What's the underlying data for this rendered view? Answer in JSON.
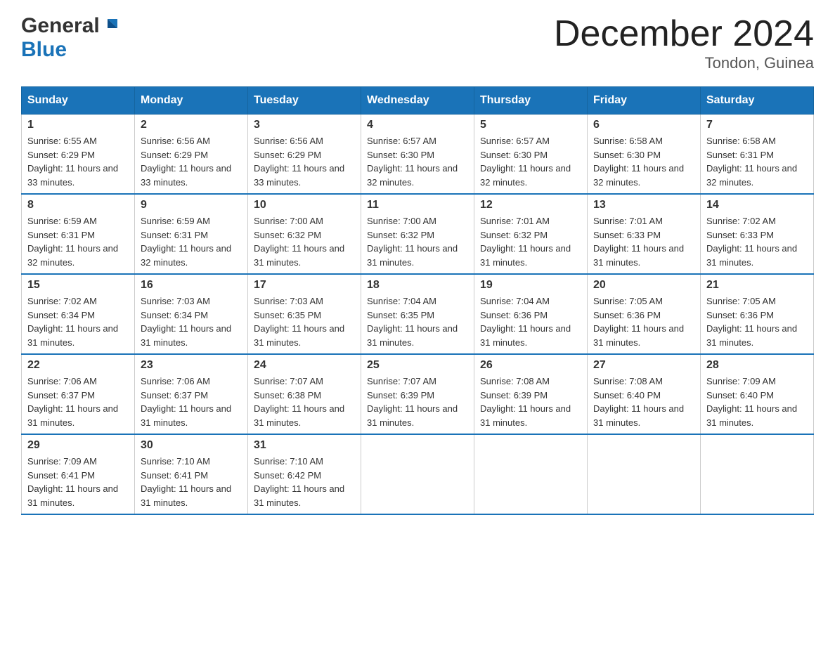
{
  "header": {
    "logo_general": "General",
    "logo_blue": "Blue",
    "title": "December 2024",
    "subtitle": "Tondon, Guinea"
  },
  "calendar": {
    "days_of_week": [
      "Sunday",
      "Monday",
      "Tuesday",
      "Wednesday",
      "Thursday",
      "Friday",
      "Saturday"
    ],
    "weeks": [
      [
        {
          "day": 1,
          "sunrise": "6:55 AM",
          "sunset": "6:29 PM",
          "daylight": "11 hours and 33 minutes."
        },
        {
          "day": 2,
          "sunrise": "6:56 AM",
          "sunset": "6:29 PM",
          "daylight": "11 hours and 33 minutes."
        },
        {
          "day": 3,
          "sunrise": "6:56 AM",
          "sunset": "6:29 PM",
          "daylight": "11 hours and 33 minutes."
        },
        {
          "day": 4,
          "sunrise": "6:57 AM",
          "sunset": "6:30 PM",
          "daylight": "11 hours and 32 minutes."
        },
        {
          "day": 5,
          "sunrise": "6:57 AM",
          "sunset": "6:30 PM",
          "daylight": "11 hours and 32 minutes."
        },
        {
          "day": 6,
          "sunrise": "6:58 AM",
          "sunset": "6:30 PM",
          "daylight": "11 hours and 32 minutes."
        },
        {
          "day": 7,
          "sunrise": "6:58 AM",
          "sunset": "6:31 PM",
          "daylight": "11 hours and 32 minutes."
        }
      ],
      [
        {
          "day": 8,
          "sunrise": "6:59 AM",
          "sunset": "6:31 PM",
          "daylight": "11 hours and 32 minutes."
        },
        {
          "day": 9,
          "sunrise": "6:59 AM",
          "sunset": "6:31 PM",
          "daylight": "11 hours and 32 minutes."
        },
        {
          "day": 10,
          "sunrise": "7:00 AM",
          "sunset": "6:32 PM",
          "daylight": "11 hours and 31 minutes."
        },
        {
          "day": 11,
          "sunrise": "7:00 AM",
          "sunset": "6:32 PM",
          "daylight": "11 hours and 31 minutes."
        },
        {
          "day": 12,
          "sunrise": "7:01 AM",
          "sunset": "6:32 PM",
          "daylight": "11 hours and 31 minutes."
        },
        {
          "day": 13,
          "sunrise": "7:01 AM",
          "sunset": "6:33 PM",
          "daylight": "11 hours and 31 minutes."
        },
        {
          "day": 14,
          "sunrise": "7:02 AM",
          "sunset": "6:33 PM",
          "daylight": "11 hours and 31 minutes."
        }
      ],
      [
        {
          "day": 15,
          "sunrise": "7:02 AM",
          "sunset": "6:34 PM",
          "daylight": "11 hours and 31 minutes."
        },
        {
          "day": 16,
          "sunrise": "7:03 AM",
          "sunset": "6:34 PM",
          "daylight": "11 hours and 31 minutes."
        },
        {
          "day": 17,
          "sunrise": "7:03 AM",
          "sunset": "6:35 PM",
          "daylight": "11 hours and 31 minutes."
        },
        {
          "day": 18,
          "sunrise": "7:04 AM",
          "sunset": "6:35 PM",
          "daylight": "11 hours and 31 minutes."
        },
        {
          "day": 19,
          "sunrise": "7:04 AM",
          "sunset": "6:36 PM",
          "daylight": "11 hours and 31 minutes."
        },
        {
          "day": 20,
          "sunrise": "7:05 AM",
          "sunset": "6:36 PM",
          "daylight": "11 hours and 31 minutes."
        },
        {
          "day": 21,
          "sunrise": "7:05 AM",
          "sunset": "6:36 PM",
          "daylight": "11 hours and 31 minutes."
        }
      ],
      [
        {
          "day": 22,
          "sunrise": "7:06 AM",
          "sunset": "6:37 PM",
          "daylight": "11 hours and 31 minutes."
        },
        {
          "day": 23,
          "sunrise": "7:06 AM",
          "sunset": "6:37 PM",
          "daylight": "11 hours and 31 minutes."
        },
        {
          "day": 24,
          "sunrise": "7:07 AM",
          "sunset": "6:38 PM",
          "daylight": "11 hours and 31 minutes."
        },
        {
          "day": 25,
          "sunrise": "7:07 AM",
          "sunset": "6:39 PM",
          "daylight": "11 hours and 31 minutes."
        },
        {
          "day": 26,
          "sunrise": "7:08 AM",
          "sunset": "6:39 PM",
          "daylight": "11 hours and 31 minutes."
        },
        {
          "day": 27,
          "sunrise": "7:08 AM",
          "sunset": "6:40 PM",
          "daylight": "11 hours and 31 minutes."
        },
        {
          "day": 28,
          "sunrise": "7:09 AM",
          "sunset": "6:40 PM",
          "daylight": "11 hours and 31 minutes."
        }
      ],
      [
        {
          "day": 29,
          "sunrise": "7:09 AM",
          "sunset": "6:41 PM",
          "daylight": "11 hours and 31 minutes."
        },
        {
          "day": 30,
          "sunrise": "7:10 AM",
          "sunset": "6:41 PM",
          "daylight": "11 hours and 31 minutes."
        },
        {
          "day": 31,
          "sunrise": "7:10 AM",
          "sunset": "6:42 PM",
          "daylight": "11 hours and 31 minutes."
        },
        null,
        null,
        null,
        null
      ]
    ]
  }
}
